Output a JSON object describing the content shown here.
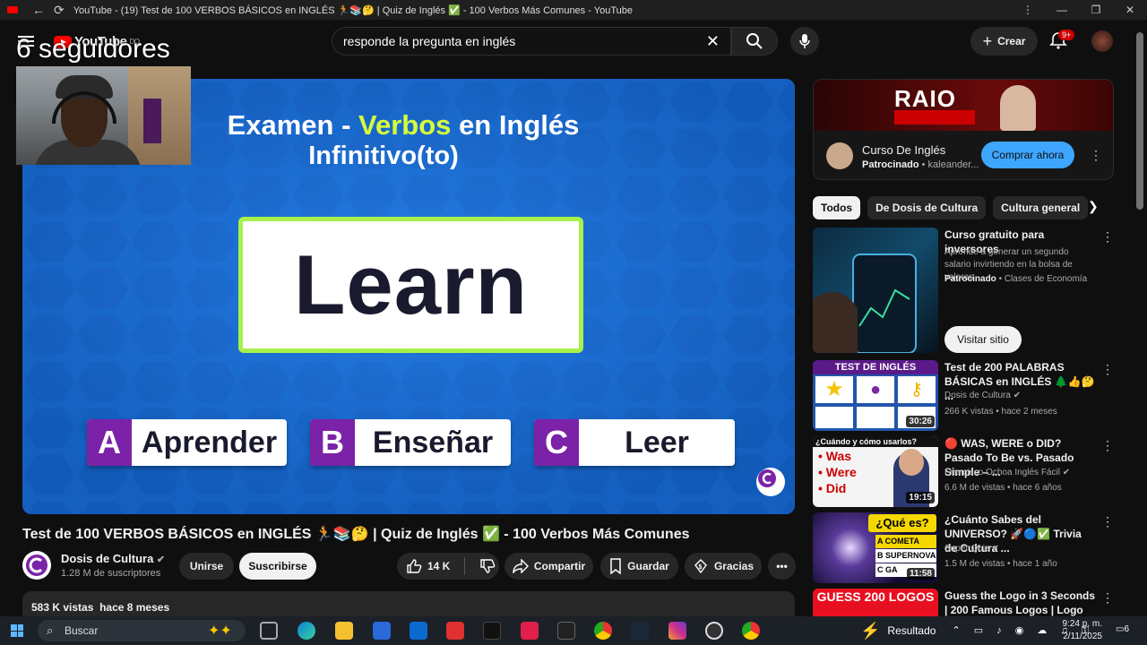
{
  "window": {
    "title": "YouTube - (19) Test de 100 VERBOS BÁSICOS en INGLÉS 🏃📚🤔 | Quiz de Inglés ✅ - 100 Verbos Más Comunes - YouTube",
    "controls": [
      "⋮",
      "—",
      "❐",
      "✕"
    ]
  },
  "header": {
    "logo_text": "YouTube",
    "logo_region": "DO",
    "search_value": "responde la pregunta en inglés",
    "create_label": "Crear",
    "notifications_badge": "9+"
  },
  "overlay": {
    "followers": "6 seguidores"
  },
  "video": {
    "heading_part1": "Examen - ",
    "heading_highlight": "Verbos",
    "heading_part2": " en Inglés",
    "subheading": "Infinitivo(to)",
    "word": "Learn",
    "options": [
      {
        "letter": "A",
        "text": "Aprender"
      },
      {
        "letter": "B",
        "text": "Enseñar"
      },
      {
        "letter": "C",
        "text": "Leer"
      }
    ]
  },
  "info": {
    "title": "Test de 100 VERBOS BÁSICOS en INGLÉS 🏃📚🤔 | Quiz de Inglés ✅ - 100 Verbos Más Comunes",
    "channel": "Dosis de Cultura",
    "subscribers": "1.28 M de suscriptores",
    "join_label": "Unirse",
    "subscribe_label": "Suscribirse",
    "likes": "14 K",
    "share_label": "Compartir",
    "save_label": "Guardar",
    "thanks_label": "Gracias",
    "views": "583 K vistas",
    "date": "hace 8 meses"
  },
  "ad": {
    "banner_text": "RAIO",
    "title": "Curso De Inglés",
    "sponsored": "Patrocinado",
    "advertiser": "kaleander...",
    "cta": "Comprar ahora"
  },
  "chips": [
    "Todos",
    "De Dosis de Cultura",
    "Cultura general"
  ],
  "recommendations": [
    {
      "title": "Curso gratuito para inversores",
      "desc": "Aprende a generar un segundo salario invirtiendo en la bolsa de valores",
      "sponsored": "Patrocinado",
      "channel": "Clases de Economía",
      "cta": "Visitar sitio"
    },
    {
      "title": "Test de 200 PALABRAS BÁSICAS en INGLÉS 🌲👍🤔 ...",
      "thumb_label": "TEST DE INGLÉS",
      "channel": "Dosis de Cultura",
      "meta": "266 K vistas • hace 2 meses",
      "duration": "30:26"
    },
    {
      "title": "🔴 WAS, WERE o DID? Pasado To Be vs. Pasado Simple – ...",
      "thumb_label": "¿Cuándo y cómo usarlos?",
      "thumb_words": [
        "Was",
        "Were",
        "Did"
      ],
      "channel": "Francisco Ochoa Inglés Fácil",
      "meta": "6.6 M de vistas • hace 6 años",
      "duration": "19:15"
    },
    {
      "title": "¿Cuánto Sabes del UNIVERSO? 🚀🔵✅ Trivia de Cultura ...",
      "thumb_label": "¿Qué es?",
      "thumb_options": [
        "COMETA",
        "SUPERNOVA",
        "GA"
      ],
      "channel": "Super Quiz",
      "meta": "1.5 M de vistas • hace 1 año",
      "duration": "11:58"
    },
    {
      "title": "Guess the Logo in 3 Seconds | 200 Famous Logos | Logo Qui...",
      "thumb_label": "GUESS 200 LOGOS"
    }
  ],
  "taskbar": {
    "search_placeholder": "Buscar",
    "weather": "Resultado",
    "time": "9:24 p. m.",
    "date": "2/11/2025",
    "notif_count": "6"
  },
  "colors": {
    "video_bg": "#1a6fd6",
    "accent_green": "#a8f04a",
    "option_purple": "#7b22a8",
    "ad_button": "#3ea6ff"
  }
}
